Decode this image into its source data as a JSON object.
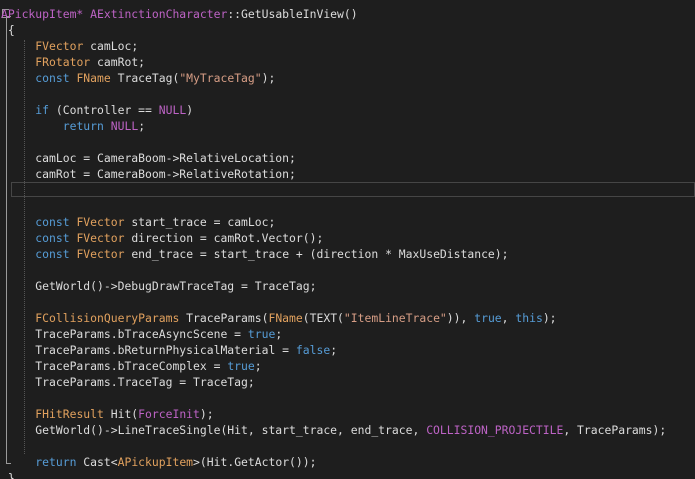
{
  "colors": {
    "background": "#1e1e1e",
    "plain": "#dcdcdc",
    "type": "#e1a15e",
    "keyword": "#569cd6",
    "string": "#d69d85",
    "macro": "#bd63c5",
    "folding_line": "#9a9a9a",
    "current_line_border": "#464646"
  },
  "lines": [
    [
      {
        "t": "APickupItem*",
        "c": "macro"
      },
      {
        "t": " ",
        "c": "plain"
      },
      {
        "t": "AExtinctionCharacter",
        "c": "macro"
      },
      {
        "t": "::GetUsableInView()",
        "c": "plain"
      }
    ],
    [
      {
        "t": " {",
        "c": "plain"
      }
    ],
    [
      {
        "t": "     ",
        "c": "plain"
      },
      {
        "t": "FVector",
        "c": "type"
      },
      {
        "t": " camLoc;",
        "c": "plain"
      }
    ],
    [
      {
        "t": "     ",
        "c": "plain"
      },
      {
        "t": "FRotator",
        "c": "type"
      },
      {
        "t": " camRot;",
        "c": "plain"
      }
    ],
    [
      {
        "t": "     ",
        "c": "plain"
      },
      {
        "t": "const",
        "c": "keyword"
      },
      {
        "t": " ",
        "c": "plain"
      },
      {
        "t": "FName",
        "c": "type"
      },
      {
        "t": " TraceTag(",
        "c": "plain"
      },
      {
        "t": "\"MyTraceTag\"",
        "c": "string"
      },
      {
        "t": ");",
        "c": "plain"
      }
    ],
    [],
    [
      {
        "t": "     ",
        "c": "plain"
      },
      {
        "t": "if",
        "c": "keyword"
      },
      {
        "t": " (Controller == ",
        "c": "plain"
      },
      {
        "t": "NULL",
        "c": "macro"
      },
      {
        "t": ")",
        "c": "plain"
      }
    ],
    [
      {
        "t": "         ",
        "c": "plain"
      },
      {
        "t": "return",
        "c": "keyword"
      },
      {
        "t": " ",
        "c": "plain"
      },
      {
        "t": "NULL",
        "c": "macro"
      },
      {
        "t": ";",
        "c": "plain"
      }
    ],
    [],
    [
      {
        "t": "     camLoc = CameraBoom->RelativeLocation;",
        "c": "plain"
      }
    ],
    [
      {
        "t": "     camRot = CameraBoom->RelativeRotation;",
        "c": "plain"
      }
    ],
    [],
    [],
    [
      {
        "t": "     ",
        "c": "plain"
      },
      {
        "t": "const",
        "c": "keyword"
      },
      {
        "t": " ",
        "c": "plain"
      },
      {
        "t": "FVector",
        "c": "type"
      },
      {
        "t": " start_trace = camLoc;",
        "c": "plain"
      }
    ],
    [
      {
        "t": "     ",
        "c": "plain"
      },
      {
        "t": "const",
        "c": "keyword"
      },
      {
        "t": " ",
        "c": "plain"
      },
      {
        "t": "FVector",
        "c": "type"
      },
      {
        "t": " direction = camRot.Vector();",
        "c": "plain"
      }
    ],
    [
      {
        "t": "     ",
        "c": "plain"
      },
      {
        "t": "const",
        "c": "keyword"
      },
      {
        "t": " ",
        "c": "plain"
      },
      {
        "t": "FVector",
        "c": "type"
      },
      {
        "t": " end_trace = start_trace + (direction * MaxUseDistance);",
        "c": "plain"
      }
    ],
    [],
    [
      {
        "t": "     GetWorld()->DebugDrawTraceTag = TraceTag;",
        "c": "plain"
      }
    ],
    [],
    [
      {
        "t": "     ",
        "c": "plain"
      },
      {
        "t": "FCollisionQueryParams",
        "c": "type"
      },
      {
        "t": " TraceParams(",
        "c": "plain"
      },
      {
        "t": "FName",
        "c": "type"
      },
      {
        "t": "(TEXT(",
        "c": "plain"
      },
      {
        "t": "\"ItemLineTrace\"",
        "c": "string"
      },
      {
        "t": ")), ",
        "c": "plain"
      },
      {
        "t": "true",
        "c": "keyword"
      },
      {
        "t": ", ",
        "c": "plain"
      },
      {
        "t": "this",
        "c": "keyword"
      },
      {
        "t": ");",
        "c": "plain"
      }
    ],
    [
      {
        "t": "     TraceParams.bTraceAsyncScene = ",
        "c": "plain"
      },
      {
        "t": "true",
        "c": "keyword"
      },
      {
        "t": ";",
        "c": "plain"
      }
    ],
    [
      {
        "t": "     TraceParams.bReturnPhysicalMaterial = ",
        "c": "plain"
      },
      {
        "t": "false",
        "c": "keyword"
      },
      {
        "t": ";",
        "c": "plain"
      }
    ],
    [
      {
        "t": "     TraceParams.bTraceComplex = ",
        "c": "plain"
      },
      {
        "t": "true",
        "c": "keyword"
      },
      {
        "t": ";",
        "c": "plain"
      }
    ],
    [
      {
        "t": "     TraceParams.TraceTag = TraceTag;",
        "c": "plain"
      }
    ],
    [],
    [
      {
        "t": "     ",
        "c": "plain"
      },
      {
        "t": "FHitResult",
        "c": "type"
      },
      {
        "t": " Hit(",
        "c": "plain"
      },
      {
        "t": "ForceInit",
        "c": "macro"
      },
      {
        "t": ");",
        "c": "plain"
      }
    ],
    [
      {
        "t": "     GetWorld()->LineTraceSingle(Hit, start_trace, end_trace, ",
        "c": "plain"
      },
      {
        "t": "COLLISION_PROJECTILE",
        "c": "macro"
      },
      {
        "t": ", TraceParams);",
        "c": "plain"
      }
    ],
    [],
    [
      {
        "t": "     ",
        "c": "plain"
      },
      {
        "t": "return",
        "c": "keyword"
      },
      {
        "t": " Cast<",
        "c": "plain"
      },
      {
        "t": "APickupItem",
        "c": "type"
      },
      {
        "t": ">(Hit.GetActor());",
        "c": "plain"
      }
    ],
    [
      {
        "t": " }",
        "c": "plain"
      }
    ]
  ]
}
